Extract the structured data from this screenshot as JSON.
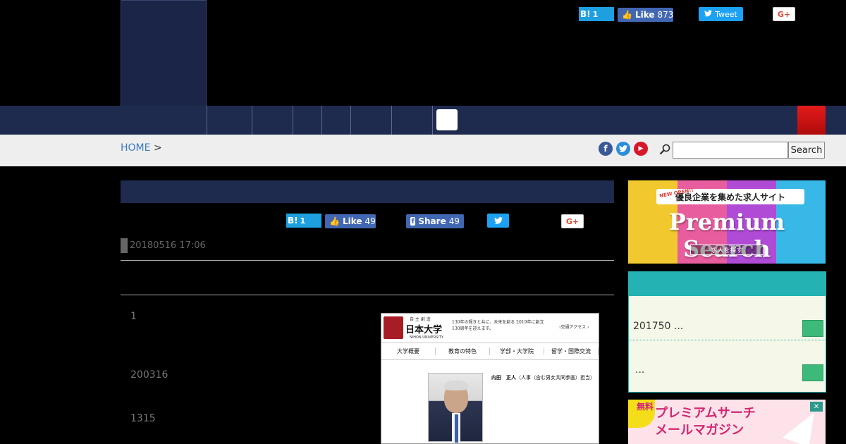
{
  "header": {
    "share": {
      "hatena_label": "B!",
      "hatena_count": "1",
      "fb_like_label": "Like",
      "fb_like_count": "873",
      "tweet_label": "Tweet",
      "gplus_label": "G+"
    }
  },
  "breadcrumb": {
    "home": "HOME",
    "separator": ">"
  },
  "social_links": {
    "facebook_glyph": "f",
    "twitter_glyph": "t",
    "youtube_glyph": "▶"
  },
  "search": {
    "placeholder": "",
    "value": "",
    "button_label": "Search"
  },
  "article": {
    "share": {
      "hatena_label": "B!",
      "hatena_count": "1",
      "fb_like_label": "Like",
      "fb_like_count": "49",
      "fb_share_label": "Share",
      "fb_share_count": "49",
      "gplus_label": "G+"
    },
    "date": "20180516 17:06",
    "paragraphs": [
      "1",
      "200316",
      "1315"
    ],
    "image": {
      "kana": "自 主 創 造",
      "name": "日本大学",
      "name_en": "NIHON UNIVERSITY",
      "tagline": "130年の輝きと共に、未来を創る 2019年に創立130周年を迎えます。",
      "access": "›交通アクセス ›",
      "nav": [
        "大学概要",
        "教育の特色",
        "学部・大学院",
        "留学・国際交流"
      ],
      "caption_name": "内田　正人",
      "caption_role": "（人事（含む男女共同参画）担当）"
    }
  },
  "sidebar": {
    "premium_banner": {
      "new_label": "NEW OPEN!!",
      "headline": "優良企業を集めた求人サイト",
      "title": "Premium Search",
      "button": "求人を探す"
    },
    "ranking": [
      {
        "text": "201750 ..."
      },
      {
        "text": "..."
      }
    ],
    "mail_banner": {
      "badge": "無料",
      "title_line1": "プレミアムサーチ",
      "title_line2": "メールマガジン",
      "close": "✕"
    }
  },
  "colors": {
    "navy": "#1e2a4e",
    "teal": "#25b2b2",
    "accent_red": "#e31b1b",
    "green_button": "#3dba7a"
  }
}
